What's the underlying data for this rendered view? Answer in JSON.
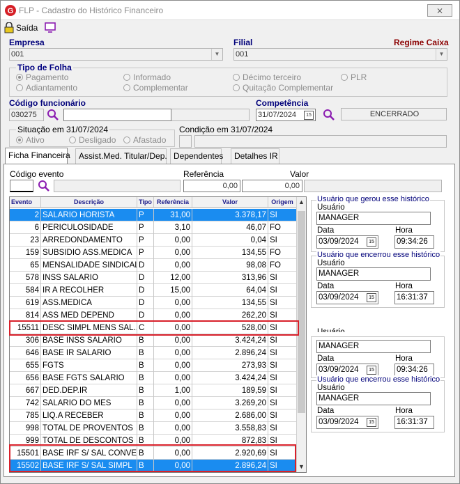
{
  "window": {
    "title": "FLP - Cadastro do Histórico Financeiro",
    "close_label": "⨯"
  },
  "toolbar": {
    "saida_label": "Saída"
  },
  "empresa": {
    "label": "Empresa",
    "value": "001"
  },
  "filial": {
    "label": "Filial",
    "value": "001",
    "regime": "Regime Caixa"
  },
  "tipo_folha": {
    "label": "Tipo de Folha",
    "options": [
      "Pagamento",
      "Informado",
      "Décimo terceiro",
      "PLR",
      "Adiantamento",
      "Complementar",
      "Quitação Complementar"
    ]
  },
  "funcionario": {
    "label": "Código funcionário",
    "code": "030275",
    "name": ""
  },
  "competencia": {
    "label": "Competência",
    "value": "31/07/2024",
    "status": "ENCERRADO"
  },
  "situacao": {
    "label": "Situação em 31/07/2024",
    "options": [
      "Ativo",
      "Desligado",
      "Afastado"
    ]
  },
  "condicao": {
    "label": "Condição em 31/07/2024"
  },
  "tabs": [
    "Ficha Financeira",
    "Assist.Med. Titular/Dep.",
    "Dependentes",
    "Detalhes IR"
  ],
  "filter": {
    "evento_label": "Código evento",
    "referencia_label": "Referência",
    "valor_label": "Valor",
    "referencia_value": "0,00",
    "valor_value": "0,00"
  },
  "grid": {
    "headers": [
      "Evento",
      "Descrição",
      "Tipo",
      "Referência",
      "Valor",
      "Origem"
    ],
    "rows": [
      [
        "2",
        "SALARIO HORISTA",
        "P",
        "31,00",
        "3.378,17",
        "SI"
      ],
      [
        "6",
        "PERICULOSIDADE",
        "P",
        "3,10",
        "46,07",
        "FO"
      ],
      [
        "23",
        "ARREDONDAMENTO",
        "P",
        "0,00",
        "0,04",
        "SI"
      ],
      [
        "159",
        "SUBSIDIO ASS.MEDICA",
        "P",
        "0,00",
        "134,55",
        "FO"
      ],
      [
        "65",
        "MENSALIDADE SINDICAL",
        "D",
        "0,00",
        "98,08",
        "FO"
      ],
      [
        "578",
        "INSS SALARIO",
        "D",
        "12,00",
        "313,96",
        "SI"
      ],
      [
        "584",
        "IR A RECOLHER",
        "D",
        "15,00",
        "64,04",
        "SI"
      ],
      [
        "619",
        "ASS.MEDICA",
        "D",
        "0,00",
        "134,55",
        "SI"
      ],
      [
        "814",
        "ASS MED DEPEND",
        "D",
        "0,00",
        "262,20",
        "SI"
      ],
      [
        "15511",
        "DESC SIMPL MENS SAL...",
        "C",
        "0,00",
        "528,00",
        "SI"
      ],
      [
        "306",
        "BASE INSS SALARIO",
        "B",
        "0,00",
        "3.424,24",
        "SI"
      ],
      [
        "646",
        "BASE IR SALARIO",
        "B",
        "0,00",
        "2.896,24",
        "SI"
      ],
      [
        "655",
        "FGTS",
        "B",
        "0,00",
        "273,93",
        "SI"
      ],
      [
        "656",
        "BASE FGTS SALARIO",
        "B",
        "0,00",
        "3.424,24",
        "SI"
      ],
      [
        "667",
        "DED.DEP.IR",
        "B",
        "1,00",
        "189,59",
        "SI"
      ],
      [
        "742",
        "SALARIO DO MES",
        "B",
        "0,00",
        "3.269,20",
        "SI"
      ],
      [
        "785",
        "LIQ.A RECEBER",
        "B",
        "0,00",
        "2.686,00",
        "SI"
      ],
      [
        "998",
        "TOTAL DE PROVENTOS",
        "B",
        "0,00",
        "3.558,83",
        "SI"
      ],
      [
        "999",
        "TOTAL DE DESCONTOS",
        "B",
        "0,00",
        "872,83",
        "SI"
      ],
      [
        "15501",
        "BASE IRF S/ SAL CONVEN",
        "B",
        "0,00",
        "2.920,69",
        "SI"
      ],
      [
        "15502",
        "BASE IRF S/ SAL SIMPL",
        "B",
        "0,00",
        "2.896,24",
        "SI"
      ]
    ]
  },
  "audit": {
    "gerou_label": "Usuário que gerou esse histórico",
    "encerrou_label": "Usuário que encerrou esse histórico",
    "usuario_label": "Usuário",
    "data_label": "Data",
    "hora_label": "Hora",
    "block1": {
      "user": "MANAGER",
      "date": "03/09/2024",
      "time": "09:34:26"
    },
    "block2": {
      "user": "MANAGER",
      "date": "03/09/2024",
      "time": "16:31:37"
    },
    "block3": {
      "user": "MANAGER",
      "date": "03/09/2024",
      "time": "09:34:26",
      "usuario_partial": "Usuário"
    },
    "block4": {
      "user": "MANAGER",
      "date": "03/09/2024",
      "time": "16:31:37"
    }
  },
  "colors": {
    "selected_row": "#1a8cf0",
    "highlight_border": "#d8202a",
    "label_blue": "#00007a",
    "regime_red": "#8b0000"
  }
}
